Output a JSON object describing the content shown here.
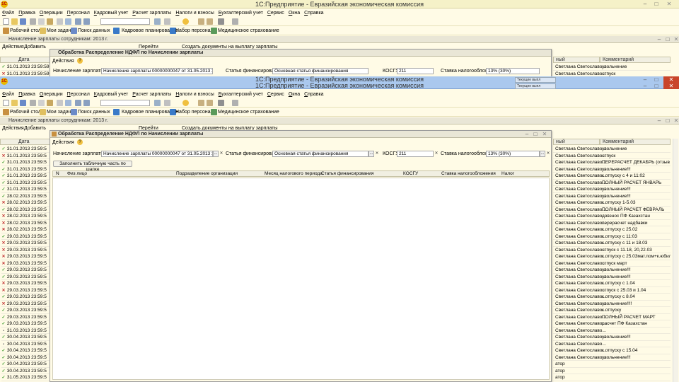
{
  "window": {
    "title": "1С:Предприятие - Евразийская экономическая комиссия",
    "logo": "1С",
    "minimize_glyph": "–",
    "maximize_glyph": "□",
    "close_glyph": "✕"
  },
  "menu": [
    "Файл",
    "Правка",
    "Операции",
    "Персонал",
    "Кадровый учет",
    "Расчет зарплаты",
    "Налоги и взносы",
    "Бухгалтерский учет",
    "Сервис",
    "Окна",
    "Справка"
  ],
  "toolbar2": {
    "desktop": "Рабочий стол",
    "tasks": "Мои задачи",
    "search": "Поиск данных",
    "planning": "Кадровое планирование",
    "recruit": "Набор персонала",
    "medical": "Медицинское страхование"
  },
  "doc": {
    "title": "Начисление зарплаты сотрудникам: 2013 г.",
    "actions": "Действия",
    "add": "Добавить",
    "goto": "Перейти",
    "create_docs": "Создать документы на выплату зарплаты",
    "col_date": "Дата",
    "col_emp": "ный",
    "col_comment": "Комментарий",
    "top_rows": [
      {
        "date": "31.01.2013 23:59:59",
        "emp": "Светлана Светославо...",
        "comment": "увольнение",
        "mark": "g"
      },
      {
        "date": "31.01.2013 23:59:59",
        "emp": "Светлана Светославо...",
        "comment": "отпуск",
        "mark": "r"
      }
    ],
    "rows": [
      {
        "date": "31.01.2013 23:59:5",
        "emp": "Светлана Светославо...",
        "comment": "увольнение",
        "mark": "g"
      },
      {
        "date": "31.01.2013 23:59:5",
        "emp": "Светлана Светославо...",
        "comment": "отпуск",
        "mark": "r"
      },
      {
        "date": "31.01.2013 23:59:5",
        "emp": "Светлана Светославо...",
        "comment": "ПЕРЕРАСЧЕТ ДЕКАБРЬ (отзыв и...",
        "mark": "g"
      },
      {
        "date": "31.01.2013 23:59:5",
        "emp": "Светлана Светославо...",
        "comment": "увольнение!!!",
        "mark": "g"
      },
      {
        "date": "31.01.2013 23:59:5",
        "emp": "Светлана Светославо...",
        "comment": "к отпуску с 4 и 11:02",
        "mark": "g"
      },
      {
        "date": "31.01.2013 23:59:5",
        "emp": "Светлана Светославо...",
        "comment": "ПОЛНЫЙ РАСЧЕТ ЯНВАРЬ",
        "mark": "g"
      },
      {
        "date": "31.01.2013 23:59:5",
        "emp": "Светлана Светославо...",
        "comment": "увольнение!!!",
        "mark": "g"
      },
      {
        "date": "28.02.2013 23:59:5",
        "emp": "Светлана Светославо...",
        "comment": "увольнение!!!",
        "mark": "g"
      },
      {
        "date": "28.02.2013 23:59:5",
        "emp": "Светлана Светославо...",
        "comment": "к отпуску 1-5.03",
        "mark": "r"
      },
      {
        "date": "28.02.2013 23:59:5",
        "emp": "Светлана Светославо...",
        "comment": "ПОЛНЫЙ РАСЧЕТ ФЕВРАЛЬ",
        "mark": "g"
      },
      {
        "date": "28.02.2013 23:59:5",
        "emp": "Светлана Светославо...",
        "comment": "довзнос ПФ Казахстан",
        "mark": "r"
      },
      {
        "date": "28.02.2013 23:59:5",
        "emp": "Светлана Светославо...",
        "comment": "перерасчет надбавки",
        "mark": "r"
      },
      {
        "date": "28.02.2013 23:59:5",
        "emp": "Светлана Светославо...",
        "comment": "к отпуску с 25.02",
        "mark": "r"
      },
      {
        "date": "29.03.2013 23:59:5",
        "emp": "Светлана Светославо...",
        "comment": "к отпуску с 11:03",
        "mark": "g"
      },
      {
        "date": "29.03.2013 23:59:5",
        "emp": "Светлана Светославо...",
        "comment": "к отпуску с 11 и 18.03",
        "mark": "r"
      },
      {
        "date": "29.03.2013 23:59:5",
        "emp": "Светлана Светославо...",
        "comment": "отпуск с 11.18, 20,22.03",
        "mark": "r"
      },
      {
        "date": "29.03.2013 23:59:5",
        "emp": "Светлана Светославо...",
        "comment": "к отпуску с 25.03мат.пом+к.юбил",
        "mark": "r"
      },
      {
        "date": "29.03.2013 23:59:5",
        "emp": "Светлана Светославо...",
        "comment": "отпуск март",
        "mark": "r"
      },
      {
        "date": "29.03.2013 23:59:5",
        "emp": "Светлана Светославо...",
        "comment": "увольнение!!!",
        "mark": "g"
      },
      {
        "date": "29.03.2013 23:59:5",
        "emp": "Светлана Светославо...",
        "comment": "увольнение!!!",
        "mark": "g"
      },
      {
        "date": "29.03.2013 23:59:5",
        "emp": "Светлана Светославо...",
        "comment": "к отпуску с 1.04",
        "mark": "r"
      },
      {
        "date": "29.03.2013 23:59:5",
        "emp": "Светлана Светославо...",
        "comment": "отпуск с 25.03 и 1.04",
        "mark": "r"
      },
      {
        "date": "29.03.2013 23:59:5",
        "emp": "Светлана Светославо...",
        "comment": "к отпуску с 8.04",
        "mark": "g"
      },
      {
        "date": "29.03.2013 23:59:5",
        "emp": "Светлана Светославо...",
        "comment": "увольнение!!!!",
        "mark": "r"
      },
      {
        "date": "29.03.2013 23:59:5",
        "emp": "Светлана Светославо...",
        "comment": "к отпуску",
        "mark": "g"
      },
      {
        "date": "29.03.2013 23:59:5",
        "emp": "Светлана Светославо...",
        "comment": "ПОЛНЫЙ РАСЧЕТ МАРТ",
        "mark": "g"
      },
      {
        "date": "29.03.2013 23:59:5",
        "emp": "Светлана Светославо...",
        "comment": "расчет ПФ Казахстан",
        "mark": "g"
      },
      {
        "date": "31.03.2013 23:59:5",
        "emp": "Светлана Светославо...",
        "comment": "",
        "mark": "b"
      },
      {
        "date": "30.04.2013 23:59:5",
        "emp": "Светлана Светославо...",
        "comment": "увольнение!!!",
        "mark": "g"
      },
      {
        "date": "30.04.2013 23:59:5",
        "emp": "Светлана Светославо...",
        "comment": "",
        "mark": "b"
      },
      {
        "date": "30.04.2013 23:59:5",
        "emp": "Светлана Светославо...",
        "comment": "к отпуску с 15.04",
        "mark": "g"
      },
      {
        "date": "30.04.2013 23:59:5",
        "emp": "Светлана Светославо...",
        "comment": "увольнение!!!",
        "mark": "g"
      },
      {
        "date": "30.04.2013 23:59:5",
        "emp": "атор",
        "comment": "",
        "mark": "g"
      },
      {
        "date": "30.04.2013 23:59:5",
        "emp": "атор",
        "comment": "",
        "mark": "g"
      },
      {
        "date": "31.05.2013 23:59:5",
        "emp": "атор",
        "comment": "",
        "mark": "g"
      }
    ]
  },
  "dialog": {
    "title": "Обработка  Распределение НДФЛ по Начислении зарплаты",
    "actions": "Действия",
    "help": "?",
    "salary_label": "Начисление зарплаты:",
    "salary_value": "Начисление зарплаты 00000000047 от 31.05.2013 23:59:59",
    "finance_label": "Статья финансирования:",
    "finance_value": "Основная статья финансирования",
    "kosgu_label": "КОСГУ:",
    "kosgu_value": "211",
    "rate_label": "Ставка налогообложения:",
    "rate_value": "13% (30%)",
    "fill_btn": "Заполнить табличную часть по шапке",
    "columns": [
      "N",
      "Физ лицо",
      "Подразделение организации",
      "Месяц налогового периода",
      "Статья финансирования",
      "КОСГУ",
      "Ставка налогообложения",
      "Налог"
    ],
    "select_glyph": "...",
    "clear_glyph": "✕"
  },
  "tooltips": [
    "Текущие выпл",
    "Текущие выпл"
  ],
  "colors": {
    "bg": "#fffbe6",
    "active_title": "#aac8ee",
    "close_red": "#c9442a",
    "check_green": "#3a9a2a",
    "check_red": "#c03030"
  }
}
